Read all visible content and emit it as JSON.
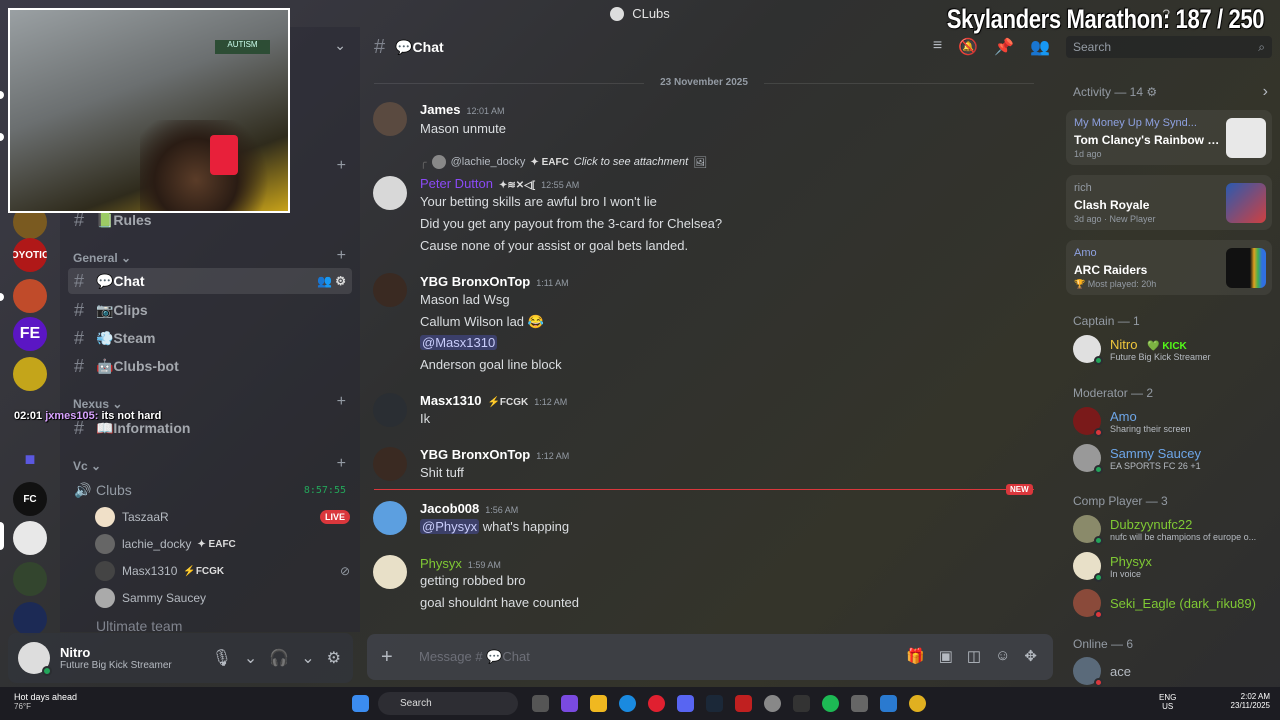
{
  "window": {
    "title": "CLubs"
  },
  "overlay": {
    "title": "Skylanders Marathon:  187 / 250"
  },
  "stream_chat": {
    "time": "02:01",
    "user": "jxmes105:",
    "message": "its not hard"
  },
  "webcam": {
    "sign_text": "AUTISM"
  },
  "rail": {
    "servers": [
      {
        "label": "OYOTIC",
        "color": "#b01818"
      },
      {
        "label": "FE",
        "color": "#5b16c4"
      },
      {
        "label": "",
        "color": "#c4a51a"
      },
      {
        "label": "",
        "color": "#2a2a2a"
      },
      {
        "label": "",
        "color": "#5b58e0"
      },
      {
        "label": "FC",
        "color": "#111111"
      },
      {
        "label": "",
        "color": "#e8e8e8"
      },
      {
        "label": "",
        "color": "#33452e"
      },
      {
        "label": "",
        "color": "#1c2a55"
      }
    ]
  },
  "sidebar": {
    "channels_top": [
      {
        "name": "📗Rules"
      }
    ],
    "categories": {
      "general": "General",
      "nexus": "Nexus",
      "vc": "Vc"
    },
    "general_channels": [
      {
        "name": "💬Chat"
      },
      {
        "name": "📷Clips"
      },
      {
        "name": "💨Steam"
      },
      {
        "name": "🤖Clubs-bot"
      }
    ],
    "nexus_channels": [
      {
        "name": "📖Information"
      }
    ],
    "voice": {
      "channel": "Clubs",
      "duration": "8:57:55",
      "users": [
        {
          "name": "TaszaaR",
          "badge": "LIVE"
        },
        {
          "name": "lachie_docky",
          "tag": "EAFC"
        },
        {
          "name": "Masx1310",
          "tag": "FCGK"
        },
        {
          "name": "Sammy Saucey"
        }
      ],
      "next": "Ultimate team"
    }
  },
  "user_panel": {
    "name": "Nitro",
    "status": "Future Big Kick Streamer"
  },
  "chat": {
    "channel_title": "💬Chat",
    "date": "23 November 2025",
    "reply": {
      "user": "@lachie_docky",
      "tag": "EAFC",
      "text": "Click to see attachment"
    },
    "messages": [
      {
        "author": "James",
        "time": "12:01 AM",
        "color": "#ffffff",
        "lines": [
          "Mason unmute"
        ]
      },
      {
        "author": "Peter Dutton",
        "time": "12:55 AM",
        "color": "#8a4af5",
        "lines": [
          "Your betting skills are awful bro I won't lie",
          "Did you get any payout from the 3-card for Chelsea?",
          "Cause none of your assist or goal bets landed."
        ]
      },
      {
        "author": "YBG BronxOnTop",
        "time": "1:11 AM",
        "color": "#ffffff",
        "lines": [
          "Mason lad Wsg",
          "Callum Wilson lad 😂",
          "@Masx1310",
          "Anderson goal line block"
        ]
      },
      {
        "author": "Masx1310",
        "time": "1:12 AM",
        "tag": "FCGK",
        "color": "#ffffff",
        "lines": [
          "Ik"
        ]
      },
      {
        "author": "YBG BronxOnTop",
        "time": "1:12 AM",
        "color": "#ffffff",
        "lines": [
          "Shit tuff"
        ]
      },
      {
        "author": "Jacob008",
        "time": "1:56 AM",
        "color": "#ffffff",
        "lines": [
          "@Physyx",
          "what's happing"
        ]
      },
      {
        "author": "Physyx",
        "time": "1:59 AM",
        "color": "#7fc934",
        "lines": [
          "getting robbed bro",
          "goal shouldnt have counted"
        ]
      }
    ],
    "new_label": "NEW",
    "composer_placeholder": "Message # 💬Chat"
  },
  "search": {
    "placeholder": "Search"
  },
  "activity": {
    "header": "Activity — 14",
    "cards": [
      {
        "line1": "My Money Up My Synd...",
        "line2": "Tom Clancy's Rainbow Six ...",
        "line3": "1d ago"
      },
      {
        "line1": "rich",
        "line2": "Clash Royale",
        "line3": "3d ago  ·  New Player"
      },
      {
        "line1": "Amo",
        "line2": "ARC Raiders",
        "line3": "🏆 Most played: 20h"
      }
    ]
  },
  "members": {
    "captain_header": "Captain — 1",
    "captain": [
      {
        "name": "Nitro",
        "tag": "KICK",
        "status": "Future Big Kick Streamer",
        "color": "#f0c73c"
      }
    ],
    "moderator_header": "Moderator — 2",
    "moderators": [
      {
        "name": "Amo",
        "status": "Sharing their screen",
        "color": "#6ea6e8"
      },
      {
        "name": "Sammy Saucey",
        "status": "EA SPORTS FC 26 +1",
        "color": "#6ea6e8"
      }
    ],
    "comp_header": "Comp Player — 3",
    "comp": [
      {
        "name": "Dubzyynufc22",
        "status": "nufc will be champions of europe o...",
        "color": "#7fc934"
      },
      {
        "name": "Physyx",
        "status": "In voice",
        "color": "#7fc934"
      },
      {
        "name": "Seki_Eagle (dark_riku89)",
        "status": "",
        "color": "#7fc934"
      }
    ],
    "online_header": "Online — 6",
    "online": [
      {
        "name": "ace",
        "color": "#b5bac1"
      }
    ]
  },
  "taskbar": {
    "weather": "Hot days ahead",
    "temp": "76°F",
    "search": "Search",
    "lang": "ENG",
    "region": "US",
    "time": "2:02 AM",
    "date": "23/11/2025"
  }
}
